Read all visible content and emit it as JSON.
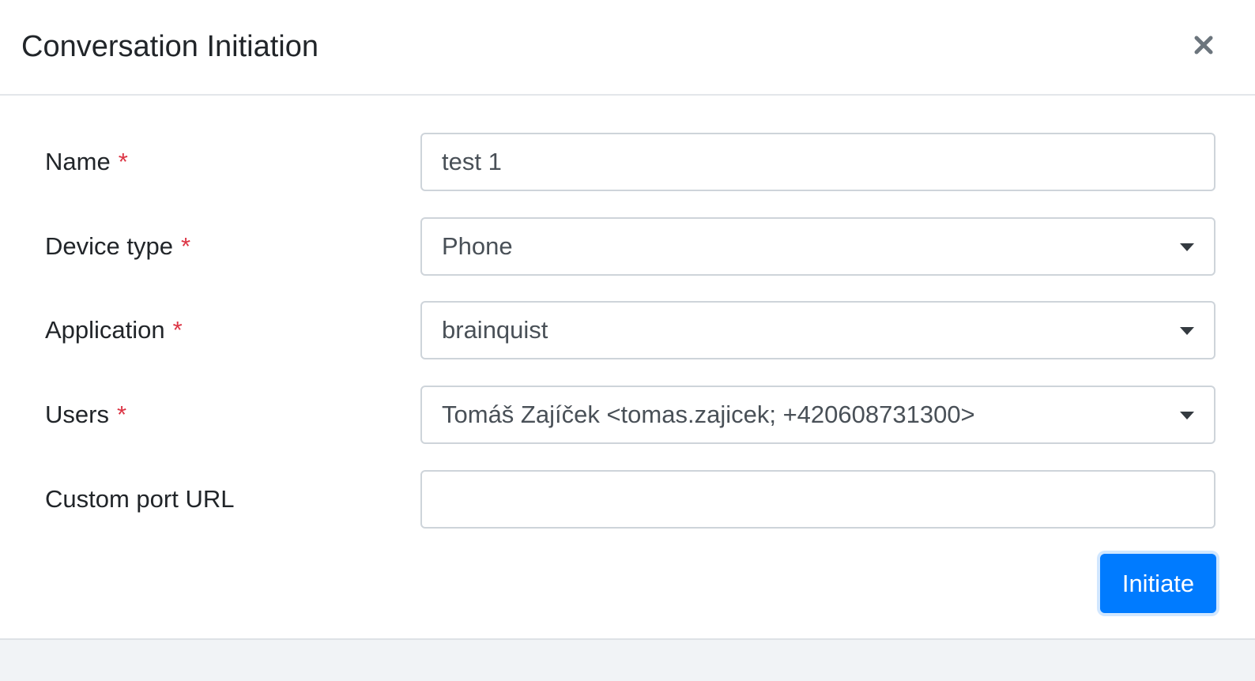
{
  "dialog": {
    "title": "Conversation Initiation"
  },
  "form": {
    "required_mark": "*",
    "fields": {
      "name": {
        "label": "Name",
        "value": "test 1",
        "required": true
      },
      "device_type": {
        "label": "Device type",
        "value": "Phone",
        "required": true
      },
      "application": {
        "label": "Application",
        "value": "brainquist",
        "required": true
      },
      "users": {
        "label": "Users",
        "value": "Tomáš Zajíček <tomas.zajicek; +420608731300>",
        "required": true
      },
      "custom_port_url": {
        "label": "Custom port URL",
        "value": "",
        "required": false
      }
    },
    "submit_label": "Initiate"
  },
  "icons": {
    "close": "close-icon",
    "dropdown": "caret-down-icon"
  },
  "colors": {
    "primary": "#007bff",
    "required": "#dc3545",
    "border": "#ced4da",
    "footer_bg": "#f1f3f6"
  }
}
